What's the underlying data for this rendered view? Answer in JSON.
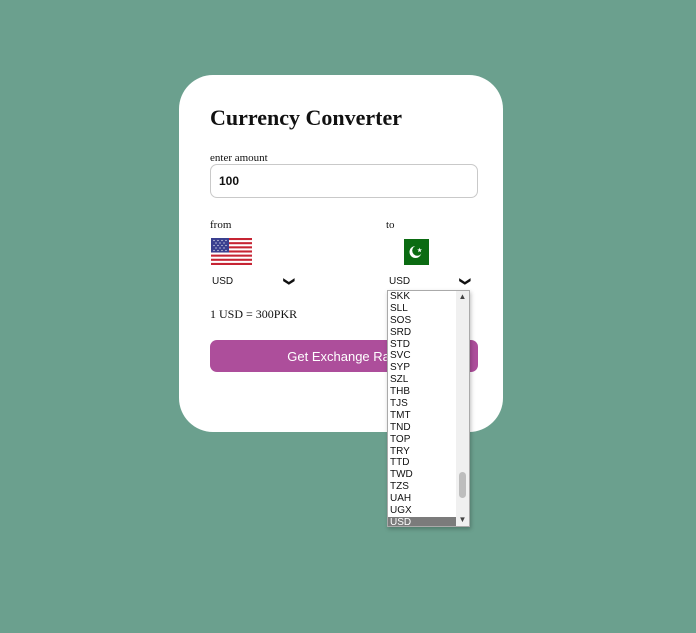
{
  "card": {
    "title": "Currency Converter",
    "amount_label": "enter amount",
    "amount_value": "100",
    "from_label": "from",
    "to_label": "to",
    "from_currency": "USD",
    "to_currency": "USD",
    "from_flag": "us-flag-icon",
    "to_flag": "pakistan-flag-icon",
    "rate_text": "1 USD = 300PKR",
    "button_label": "Get Exchange Rate"
  },
  "dropdown": {
    "options": [
      "SKK",
      "SLL",
      "SOS",
      "SRD",
      "STD",
      "SVC",
      "SYP",
      "SZL",
      "THB",
      "TJS",
      "TMT",
      "TND",
      "TOP",
      "TRY",
      "TTD",
      "TWD",
      "TZS",
      "UAH",
      "UGX",
      "USD"
    ],
    "selected": "USD",
    "scroll_up_icon": "scroll-up-arrow-icon",
    "scroll_down_icon": "scroll-down-arrow-icon"
  },
  "colors": {
    "background": "#6ba08e",
    "button": "#ad4e9b",
    "selected_option": "#7b7b7b"
  }
}
